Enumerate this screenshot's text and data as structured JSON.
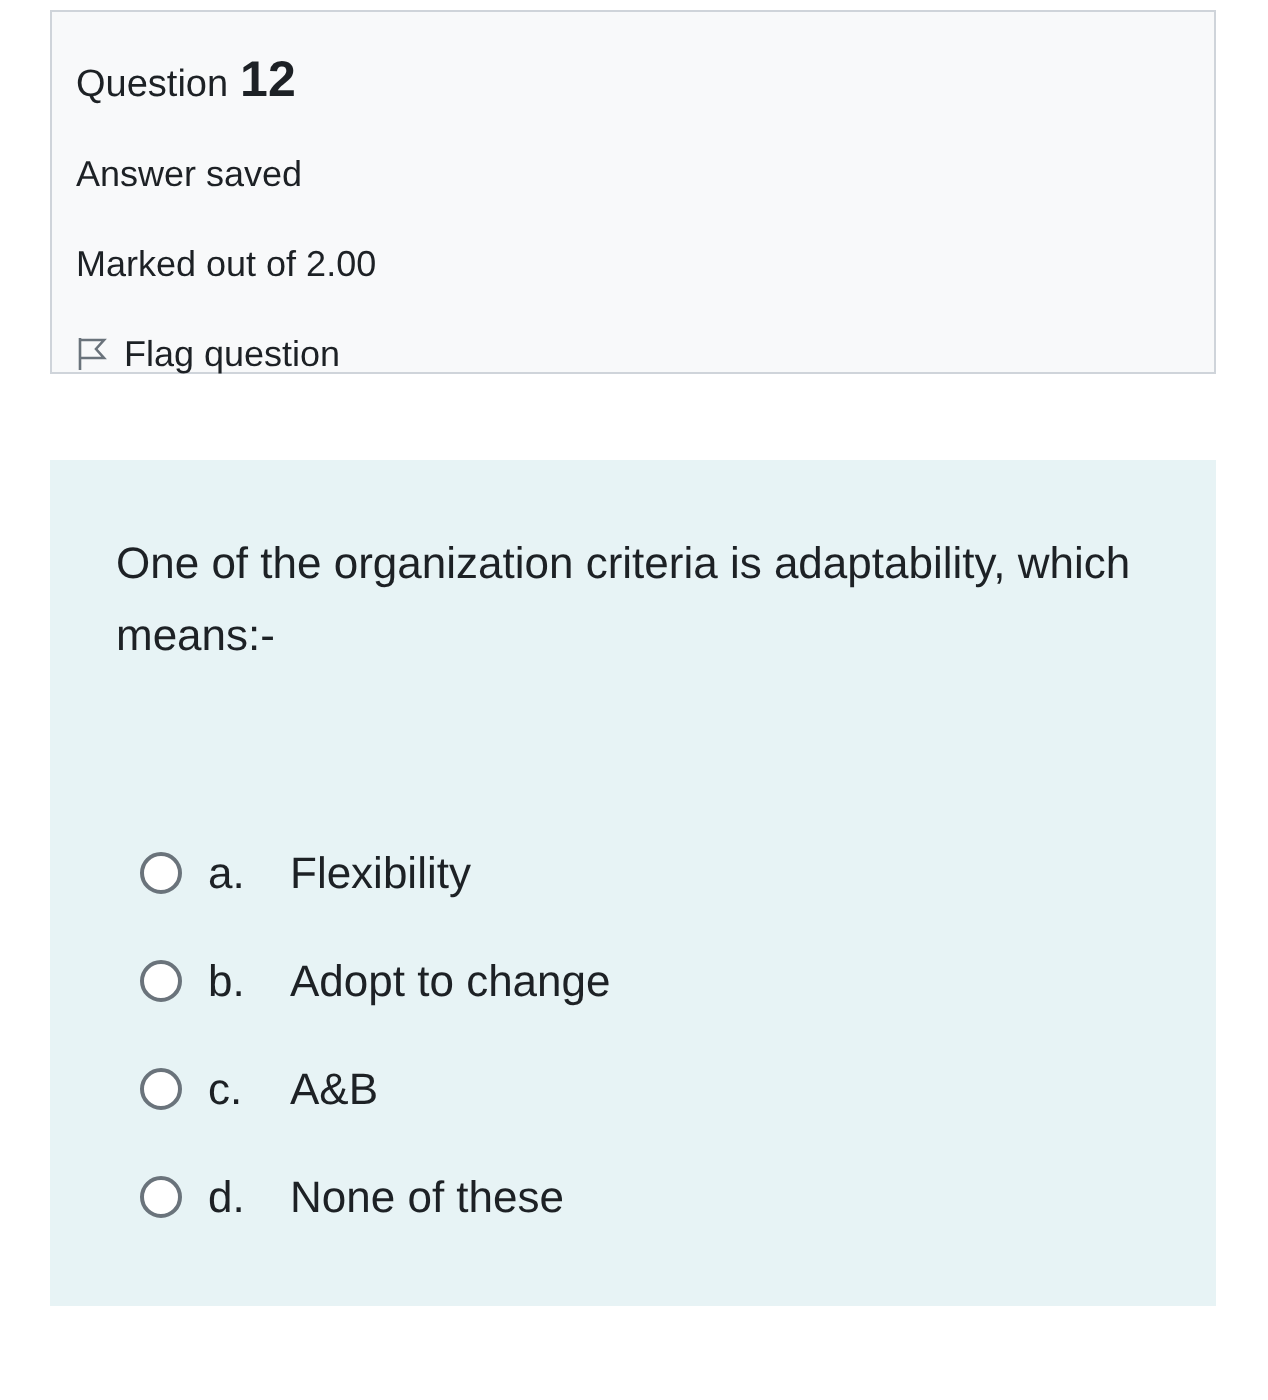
{
  "info": {
    "label": "Question",
    "number": "12",
    "status": "Answer saved",
    "mark": "Marked out of 2.00",
    "flag": {
      "label": "Flag question",
      "flagged": false
    }
  },
  "question": {
    "text": "One of the organization criteria is adaptability, which means:-",
    "options": [
      {
        "letter": "a.",
        "text": "Flexibility",
        "selected": false
      },
      {
        "letter": "b.",
        "text": "Adopt to change",
        "selected": false
      },
      {
        "letter": "c.",
        "text": "A&B",
        "selected": false
      },
      {
        "letter": "d.",
        "text": "None of these",
        "selected": false
      }
    ]
  }
}
